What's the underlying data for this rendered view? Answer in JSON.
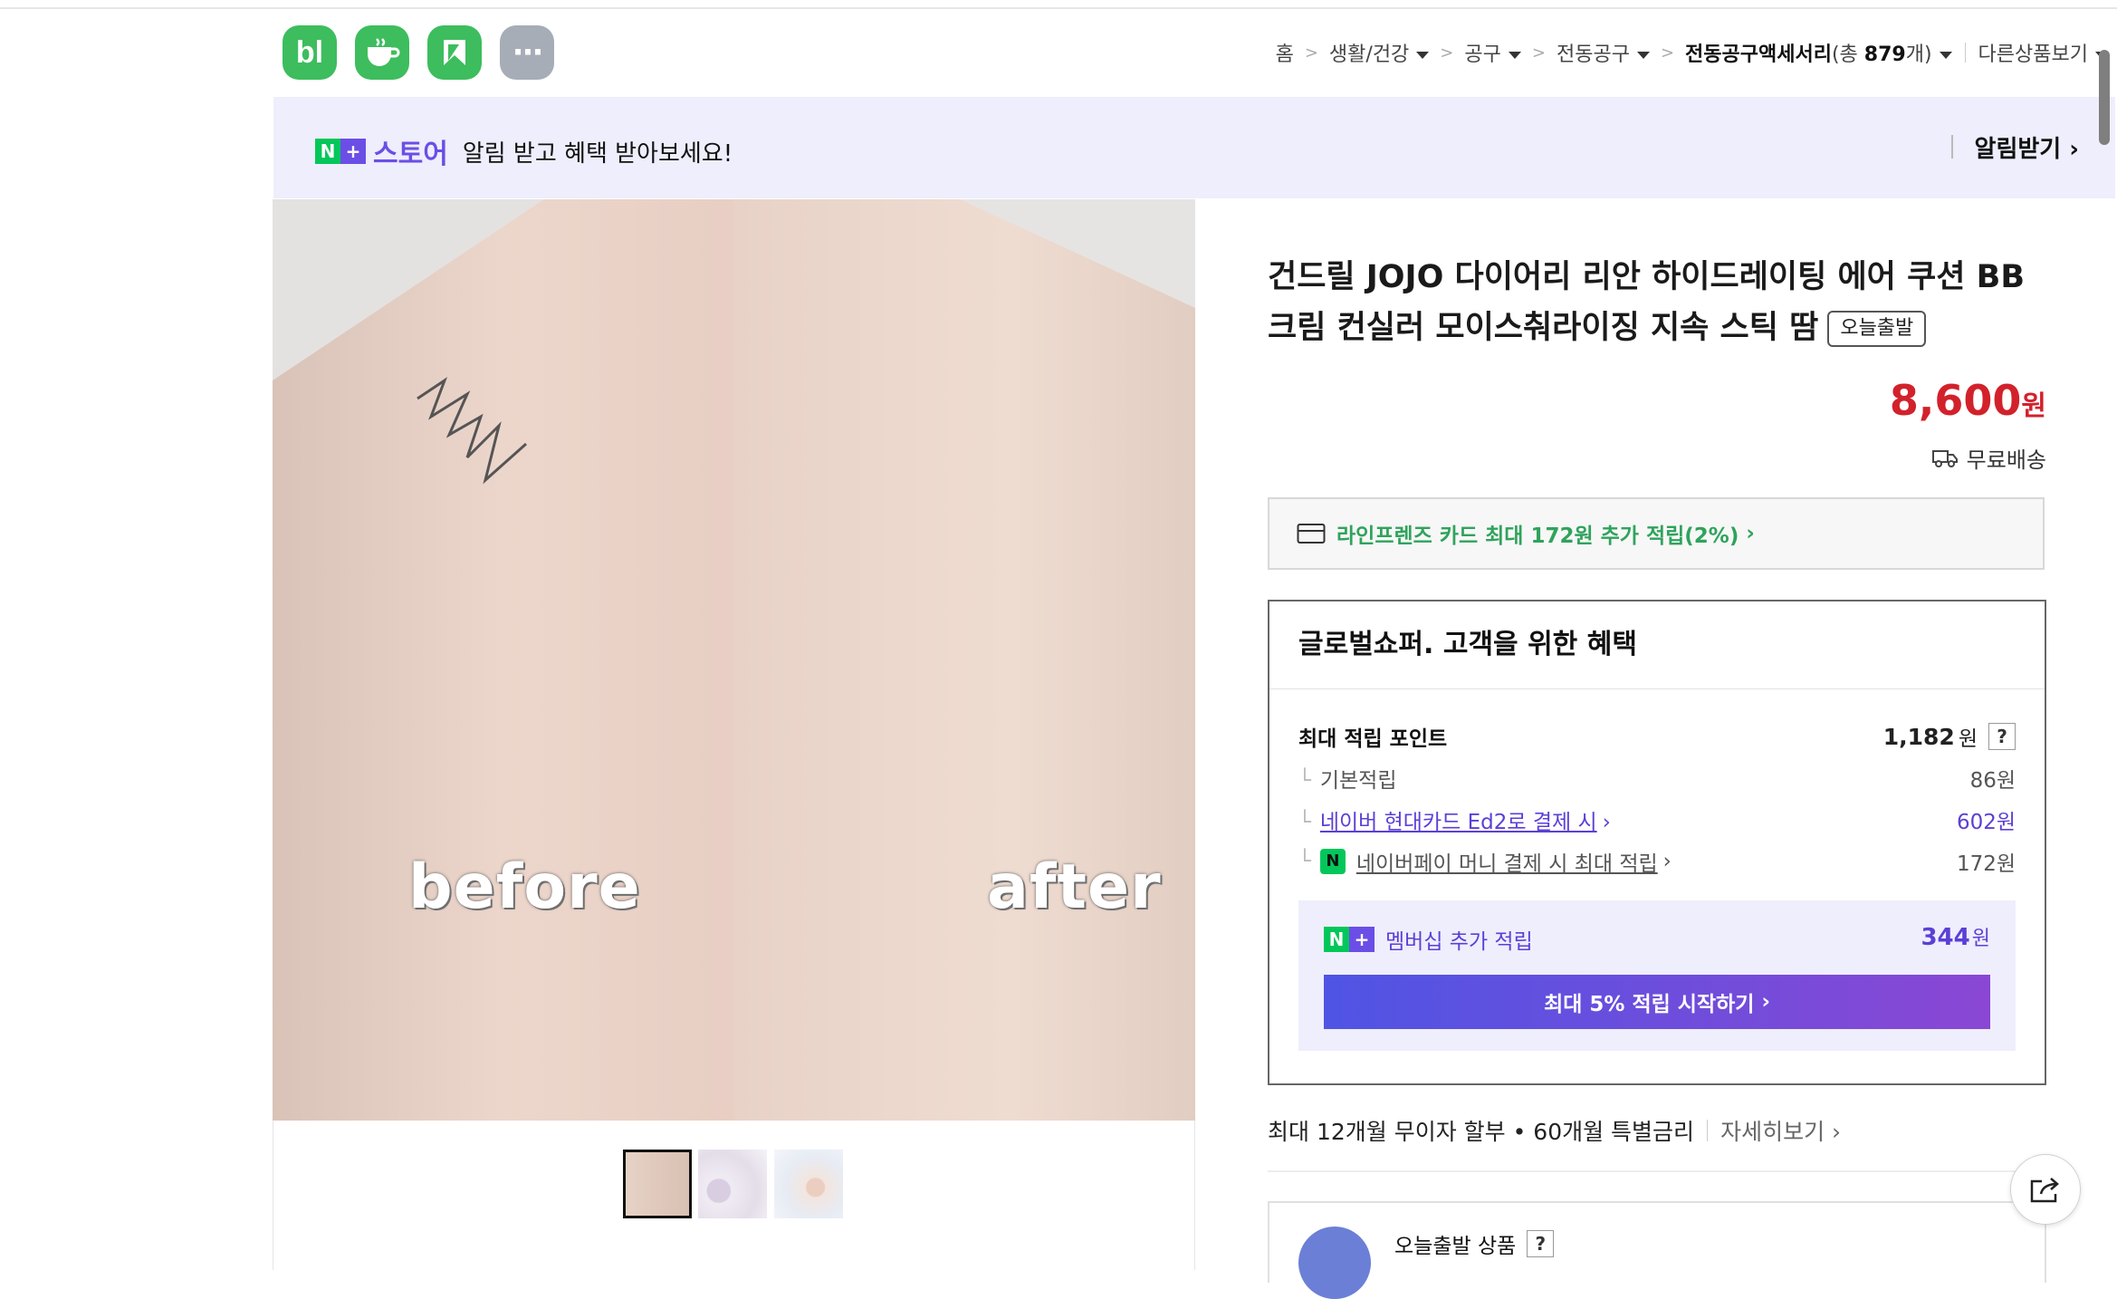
{
  "header": {
    "apps": [
      {
        "name": "blog",
        "label": "bl",
        "color": "#3dbd5e"
      },
      {
        "name": "cafe",
        "label": "",
        "color": "#3dbd5e"
      },
      {
        "name": "bookmark",
        "label": "",
        "color": "#3dbd5e"
      },
      {
        "name": "more",
        "label": "···",
        "color": "#a7adb7"
      }
    ],
    "breadcrumb": {
      "home": "홈",
      "c1": "생활/건강",
      "c2": "공구",
      "c3": "전동공구",
      "current": "전동공구액세서리",
      "count_prefix": "(총 ",
      "count": "879",
      "count_suffix": "개)",
      "other": "다른상품보기"
    }
  },
  "banner": {
    "store": "스토어",
    "message": "알림 받고 혜택 받아보세요!",
    "action": "알림받기"
  },
  "gallery": {
    "before_label": "before",
    "after_label": "after"
  },
  "product": {
    "title": "건드릴 JOJO 다이어리 리안 하이드레이팅 에어 쿠션 BB 크림 컨실러 모이스춰라이징 지속 스틱 땀",
    "badge": "오늘출발",
    "price": "8,600",
    "currency": "원",
    "shipping": "무료배송"
  },
  "card_promo": "라인프렌즈 카드 최대 172원 추가 적립(2%)",
  "benefit": {
    "heading": "글로벌쇼퍼. 고객을 위한 혜택",
    "max_points_label": "최대 적립 포인트",
    "max_points_value": "1,182",
    "unit": "원",
    "rows": [
      {
        "label": "기본적립",
        "value": "86원"
      },
      {
        "label": "네이버 현대카드 Ed2로 결제 시",
        "value": "602원"
      },
      {
        "label": "네이버페이 머니 결제 시 최대 적립",
        "value": "172원"
      }
    ],
    "membership_label": "멤버십 추가 적립",
    "membership_value": "344",
    "membership_button": "최대 5% 적립 시작하기"
  },
  "installment": {
    "text": "최대 12개월 무이자 할부 • 60개월 특별금리",
    "link": "자세히보기"
  },
  "today_ship": {
    "label": "오늘출발 상품"
  },
  "colors": {
    "accent_green": "#03c75a",
    "price_red": "#d2212b",
    "naver_purple": "#6b4ee6",
    "link_purple": "#5c3fd6"
  }
}
